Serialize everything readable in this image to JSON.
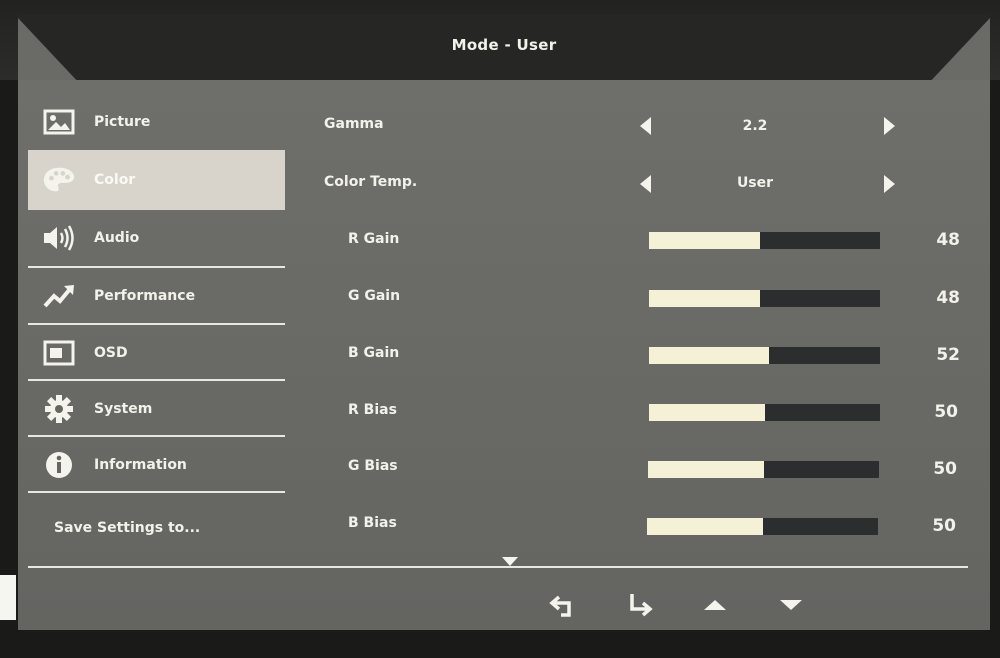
{
  "title": "Mode - User",
  "sidebar": {
    "items": [
      {
        "label": "Picture",
        "icon": "picture-icon"
      },
      {
        "label": "Color",
        "icon": "palette-icon",
        "active": true
      },
      {
        "label": "Audio",
        "icon": "speaker-icon"
      },
      {
        "label": "Performance",
        "icon": "trend-arrow-icon"
      },
      {
        "label": "OSD",
        "icon": "osd-window-icon"
      },
      {
        "label": "System",
        "icon": "gear-icon"
      },
      {
        "label": "Information",
        "icon": "info-icon"
      }
    ],
    "save_label": "Save Settings to..."
  },
  "settings": {
    "gamma": {
      "label": "Gamma",
      "value": "2.2"
    },
    "color_temp": {
      "label": "Color Temp.",
      "value": "User"
    },
    "sliders": [
      {
        "label": "R Gain",
        "value": 48,
        "max": 100
      },
      {
        "label": "G Gain",
        "value": 48,
        "max": 100
      },
      {
        "label": "B Gain",
        "value": 52,
        "max": 100
      },
      {
        "label": "R Bias",
        "value": 50,
        "max": 100
      },
      {
        "label": "G Bias",
        "value": 50,
        "max": 100
      },
      {
        "label": "B Bias",
        "value": 50,
        "max": 100
      }
    ]
  },
  "nav_buttons": [
    "back-icon",
    "enter-icon",
    "up-arrow-icon",
    "down-arrow-icon"
  ],
  "colors": {
    "fill": "#f4f1d6",
    "track": "#2b2d2e",
    "active_bg": "#d8d4cc"
  }
}
